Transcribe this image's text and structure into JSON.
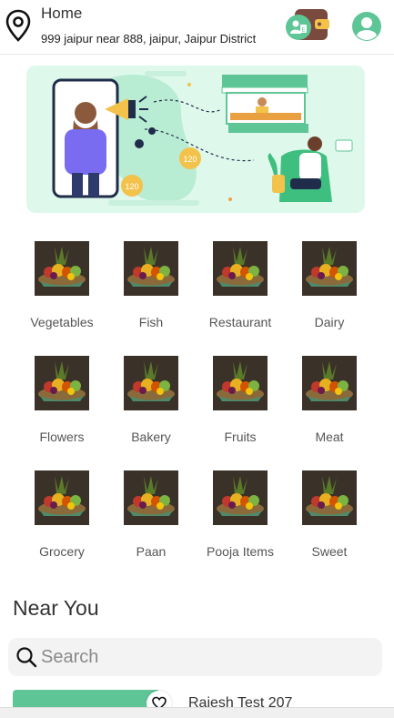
{
  "header": {
    "label": "Home",
    "address": "999 jaipur near 888, jaipur, Jaipur District"
  },
  "categories": [
    {
      "label": "Vegetables"
    },
    {
      "label": "Fish"
    },
    {
      "label": "Restaurant"
    },
    {
      "label": "Dairy"
    },
    {
      "label": "Flowers"
    },
    {
      "label": "Bakery"
    },
    {
      "label": "Fruits"
    },
    {
      "label": "Meat"
    },
    {
      "label": "Grocery"
    },
    {
      "label": "Paan"
    },
    {
      "label": "Pooja Items"
    },
    {
      "label": "Sweet"
    }
  ],
  "banner": {
    "coin_values": [
      "120",
      "120"
    ]
  },
  "near_title": "Near You",
  "search": {
    "placeholder": "Search"
  },
  "store": {
    "name": "Rajesh Test 207"
  },
  "colors": {
    "brand_green": "#5ec597",
    "light_green": "#dff8ec"
  }
}
